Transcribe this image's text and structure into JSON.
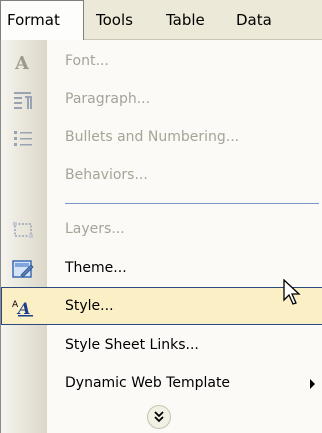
{
  "menubar": {
    "items": [
      {
        "label": "Format",
        "active": true
      },
      {
        "label": "Tools"
      },
      {
        "label": "Table"
      },
      {
        "label": "Data"
      }
    ]
  },
  "format_menu": {
    "items": [
      {
        "label": "Font...",
        "icon": "font-icon",
        "enabled": false
      },
      {
        "label": "Paragraph...",
        "icon": "paragraph-icon",
        "enabled": false
      },
      {
        "label": "Bullets and Numbering...",
        "icon": "bullets-icon",
        "enabled": false
      },
      {
        "label": "Behaviors...",
        "enabled": false
      },
      {
        "label": "Layers...",
        "icon": "layers-icon",
        "enabled": false
      },
      {
        "label": "Theme...",
        "icon": "theme-icon",
        "enabled": true
      },
      {
        "label": "Style...",
        "icon": "style-icon",
        "enabled": true,
        "highlighted": true
      },
      {
        "label": "Style Sheet Links...",
        "enabled": true
      },
      {
        "label": "Dynamic Web Template",
        "enabled": true,
        "has_submenu": true
      }
    ],
    "expand_icon": "double-chevron-down-icon"
  },
  "colors": {
    "highlight_bg": "#fbefc5",
    "highlight_border": "#2a4a80",
    "disabled_text": "#a5a497",
    "menubar_bg": "#ece9d8"
  }
}
